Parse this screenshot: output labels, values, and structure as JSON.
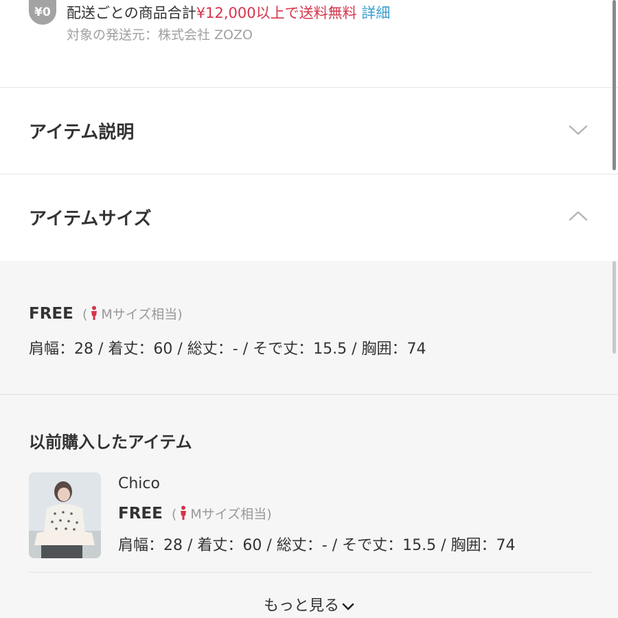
{
  "shipping": {
    "badge": "¥0",
    "line_prefix": "配送ごとの商品合計",
    "line_amount": "¥12,000以上で",
    "line_free": "送料無料",
    "details_link": "詳細",
    "sub_text": "対象の発送元：株式会社 ZOZO"
  },
  "sections": {
    "description_title": "アイテム説明",
    "size_title": "アイテムサイズ"
  },
  "size_info": {
    "size_name": "FREE",
    "equivalent_open": "(",
    "equivalent": "Mサイズ相当)",
    "measurements": "肩幅：28 / 着丈：60 / 総丈：- / そで丈：15.5 / 胸囲：74"
  },
  "previous_purchases": {
    "title": "以前購入したアイテム",
    "items": [
      {
        "brand": "Chico",
        "size_name": "FREE",
        "equivalent_open": "(",
        "equivalent": "Mサイズ相当)",
        "measurements": "肩幅：28 / 着丈：60 / 総丈：- / そで丈：15.5 / 胸囲：74"
      }
    ],
    "more_label": "もっと見る"
  },
  "colors": {
    "accent_red": "#d6344a",
    "link_blue": "#3a9ecf",
    "panel_bg": "#f6f6f6"
  }
}
